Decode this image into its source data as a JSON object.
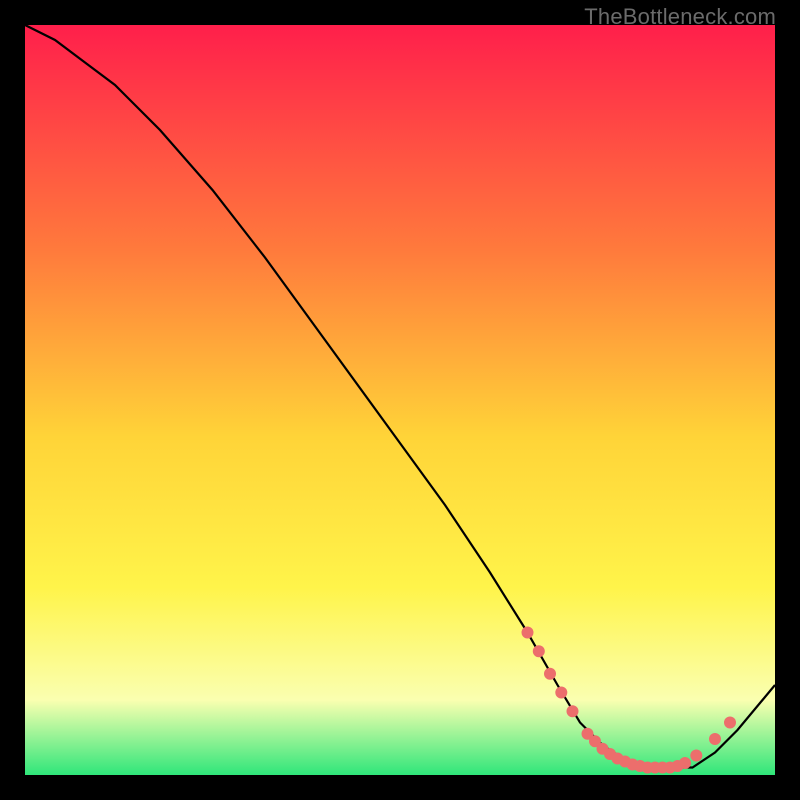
{
  "watermark": "TheBottleneck.com",
  "colors": {
    "gradient_top": "#ff1f4b",
    "gradient_mid1": "#ff7a3c",
    "gradient_mid2": "#ffd438",
    "gradient_mid3": "#fff44a",
    "gradient_mid4": "#faffb0",
    "gradient_bottom": "#2fe67a",
    "curve": "#000000",
    "markers": "#ec6e6c",
    "background": "#000000"
  },
  "chart_data": {
    "type": "line",
    "title": "",
    "xlabel": "",
    "ylabel": "",
    "xlim": [
      0,
      100
    ],
    "ylim": [
      0,
      100
    ],
    "series": [
      {
        "name": "curve",
        "x": [
          0,
          4,
          8,
          12,
          18,
          25,
          32,
          40,
          48,
          56,
          62,
          67,
          71,
          74,
          77,
          80,
          83,
          86,
          89,
          92,
          95,
          100
        ],
        "values": [
          100,
          98,
          95,
          92,
          86,
          78,
          69,
          58,
          47,
          36,
          27,
          19,
          12,
          7,
          4,
          2,
          1,
          1,
          1,
          3,
          6,
          12
        ]
      }
    ],
    "markers": [
      {
        "x": 67,
        "y": 19
      },
      {
        "x": 68.5,
        "y": 16.5
      },
      {
        "x": 70,
        "y": 13.5
      },
      {
        "x": 71.5,
        "y": 11
      },
      {
        "x": 73,
        "y": 8.5
      },
      {
        "x": 75,
        "y": 5.5
      },
      {
        "x": 76,
        "y": 4.5
      },
      {
        "x": 77,
        "y": 3.5
      },
      {
        "x": 78,
        "y": 2.8
      },
      {
        "x": 79,
        "y": 2.2
      },
      {
        "x": 80,
        "y": 1.8
      },
      {
        "x": 81,
        "y": 1.4
      },
      {
        "x": 82,
        "y": 1.2
      },
      {
        "x": 83,
        "y": 1.0
      },
      {
        "x": 84,
        "y": 1.0
      },
      {
        "x": 85,
        "y": 1.0
      },
      {
        "x": 86,
        "y": 1.0
      },
      {
        "x": 87,
        "y": 1.2
      },
      {
        "x": 88,
        "y": 1.6
      },
      {
        "x": 89.5,
        "y": 2.6
      },
      {
        "x": 92,
        "y": 4.8
      },
      {
        "x": 94,
        "y": 7
      }
    ],
    "annotations": []
  }
}
